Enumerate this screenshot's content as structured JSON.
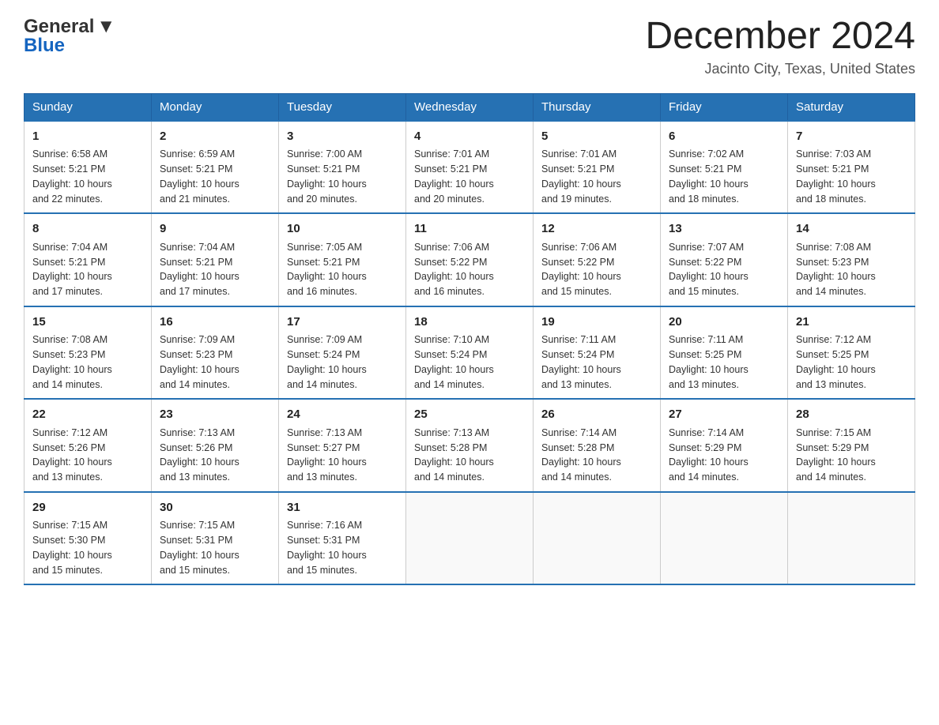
{
  "header": {
    "logo_line1": "General",
    "logo_line2": "Blue",
    "month_title": "December 2024",
    "location": "Jacinto City, Texas, United States"
  },
  "calendar": {
    "days_of_week": [
      "Sunday",
      "Monday",
      "Tuesday",
      "Wednesday",
      "Thursday",
      "Friday",
      "Saturday"
    ],
    "weeks": [
      [
        {
          "day": "1",
          "sunrise": "6:58 AM",
          "sunset": "5:21 PM",
          "daylight": "10 hours and 22 minutes."
        },
        {
          "day": "2",
          "sunrise": "6:59 AM",
          "sunset": "5:21 PM",
          "daylight": "10 hours and 21 minutes."
        },
        {
          "day": "3",
          "sunrise": "7:00 AM",
          "sunset": "5:21 PM",
          "daylight": "10 hours and 20 minutes."
        },
        {
          "day": "4",
          "sunrise": "7:01 AM",
          "sunset": "5:21 PM",
          "daylight": "10 hours and 20 minutes."
        },
        {
          "day": "5",
          "sunrise": "7:01 AM",
          "sunset": "5:21 PM",
          "daylight": "10 hours and 19 minutes."
        },
        {
          "day": "6",
          "sunrise": "7:02 AM",
          "sunset": "5:21 PM",
          "daylight": "10 hours and 18 minutes."
        },
        {
          "day": "7",
          "sunrise": "7:03 AM",
          "sunset": "5:21 PM",
          "daylight": "10 hours and 18 minutes."
        }
      ],
      [
        {
          "day": "8",
          "sunrise": "7:04 AM",
          "sunset": "5:21 PM",
          "daylight": "10 hours and 17 minutes."
        },
        {
          "day": "9",
          "sunrise": "7:04 AM",
          "sunset": "5:21 PM",
          "daylight": "10 hours and 17 minutes."
        },
        {
          "day": "10",
          "sunrise": "7:05 AM",
          "sunset": "5:21 PM",
          "daylight": "10 hours and 16 minutes."
        },
        {
          "day": "11",
          "sunrise": "7:06 AM",
          "sunset": "5:22 PM",
          "daylight": "10 hours and 16 minutes."
        },
        {
          "day": "12",
          "sunrise": "7:06 AM",
          "sunset": "5:22 PM",
          "daylight": "10 hours and 15 minutes."
        },
        {
          "day": "13",
          "sunrise": "7:07 AM",
          "sunset": "5:22 PM",
          "daylight": "10 hours and 15 minutes."
        },
        {
          "day": "14",
          "sunrise": "7:08 AM",
          "sunset": "5:23 PM",
          "daylight": "10 hours and 14 minutes."
        }
      ],
      [
        {
          "day": "15",
          "sunrise": "7:08 AM",
          "sunset": "5:23 PM",
          "daylight": "10 hours and 14 minutes."
        },
        {
          "day": "16",
          "sunrise": "7:09 AM",
          "sunset": "5:23 PM",
          "daylight": "10 hours and 14 minutes."
        },
        {
          "day": "17",
          "sunrise": "7:09 AM",
          "sunset": "5:24 PM",
          "daylight": "10 hours and 14 minutes."
        },
        {
          "day": "18",
          "sunrise": "7:10 AM",
          "sunset": "5:24 PM",
          "daylight": "10 hours and 14 minutes."
        },
        {
          "day": "19",
          "sunrise": "7:11 AM",
          "sunset": "5:24 PM",
          "daylight": "10 hours and 13 minutes."
        },
        {
          "day": "20",
          "sunrise": "7:11 AM",
          "sunset": "5:25 PM",
          "daylight": "10 hours and 13 minutes."
        },
        {
          "day": "21",
          "sunrise": "7:12 AM",
          "sunset": "5:25 PM",
          "daylight": "10 hours and 13 minutes."
        }
      ],
      [
        {
          "day": "22",
          "sunrise": "7:12 AM",
          "sunset": "5:26 PM",
          "daylight": "10 hours and 13 minutes."
        },
        {
          "day": "23",
          "sunrise": "7:13 AM",
          "sunset": "5:26 PM",
          "daylight": "10 hours and 13 minutes."
        },
        {
          "day": "24",
          "sunrise": "7:13 AM",
          "sunset": "5:27 PM",
          "daylight": "10 hours and 13 minutes."
        },
        {
          "day": "25",
          "sunrise": "7:13 AM",
          "sunset": "5:28 PM",
          "daylight": "10 hours and 14 minutes."
        },
        {
          "day": "26",
          "sunrise": "7:14 AM",
          "sunset": "5:28 PM",
          "daylight": "10 hours and 14 minutes."
        },
        {
          "day": "27",
          "sunrise": "7:14 AM",
          "sunset": "5:29 PM",
          "daylight": "10 hours and 14 minutes."
        },
        {
          "day": "28",
          "sunrise": "7:15 AM",
          "sunset": "5:29 PM",
          "daylight": "10 hours and 14 minutes."
        }
      ],
      [
        {
          "day": "29",
          "sunrise": "7:15 AM",
          "sunset": "5:30 PM",
          "daylight": "10 hours and 15 minutes."
        },
        {
          "day": "30",
          "sunrise": "7:15 AM",
          "sunset": "5:31 PM",
          "daylight": "10 hours and 15 minutes."
        },
        {
          "day": "31",
          "sunrise": "7:16 AM",
          "sunset": "5:31 PM",
          "daylight": "10 hours and 15 minutes."
        },
        null,
        null,
        null,
        null
      ]
    ],
    "labels": {
      "sunrise": "Sunrise:",
      "sunset": "Sunset:",
      "daylight": "Daylight:"
    }
  }
}
